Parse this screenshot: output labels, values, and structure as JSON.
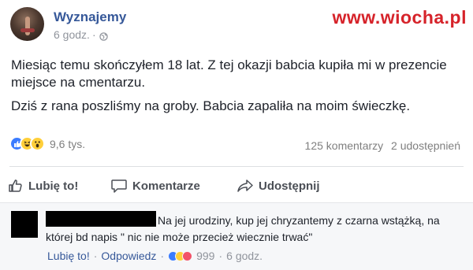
{
  "watermark": "www.wiocha.pl",
  "post": {
    "page_name": "Wyznajemy",
    "time": "6 godz.",
    "separator": "·",
    "paragraphs": [
      "Miesiąc temu skończyłem 18 lat. Z tej okazji babcia kupiła mi w prezencie miejsce na cmentarzu.",
      "Dziś z rana poszliśmy na groby. Babcia zapaliła na moim świeczkę."
    ],
    "reaction_count": "9,6 tys.",
    "comments_count": "125 komentarzy",
    "shares_count": "2 udostępnień",
    "reactions": [
      "like-icon",
      "haha-icon",
      "wow-icon"
    ]
  },
  "actions": {
    "like": "Lubię to!",
    "comment": "Komentarze",
    "share": "Udostępnij"
  },
  "comment": {
    "text": "Na jej urodziny, kup jej chryzantemy z czarna wstążką, na której bd napis \" nic nie może przecież wiecznie trwać\"",
    "like_label": "Lubię to!",
    "reply_label": "Odpowiedz",
    "separator": "·",
    "reaction_count": "999",
    "time": "6 godz.",
    "reactions": [
      "like-icon",
      "haha-icon",
      "love-icon"
    ]
  },
  "colors": {
    "link": "#365899",
    "watermark": "#d6232a",
    "like": "#3b7cff",
    "haha": "#ffcf3a",
    "love": "#f25268"
  }
}
